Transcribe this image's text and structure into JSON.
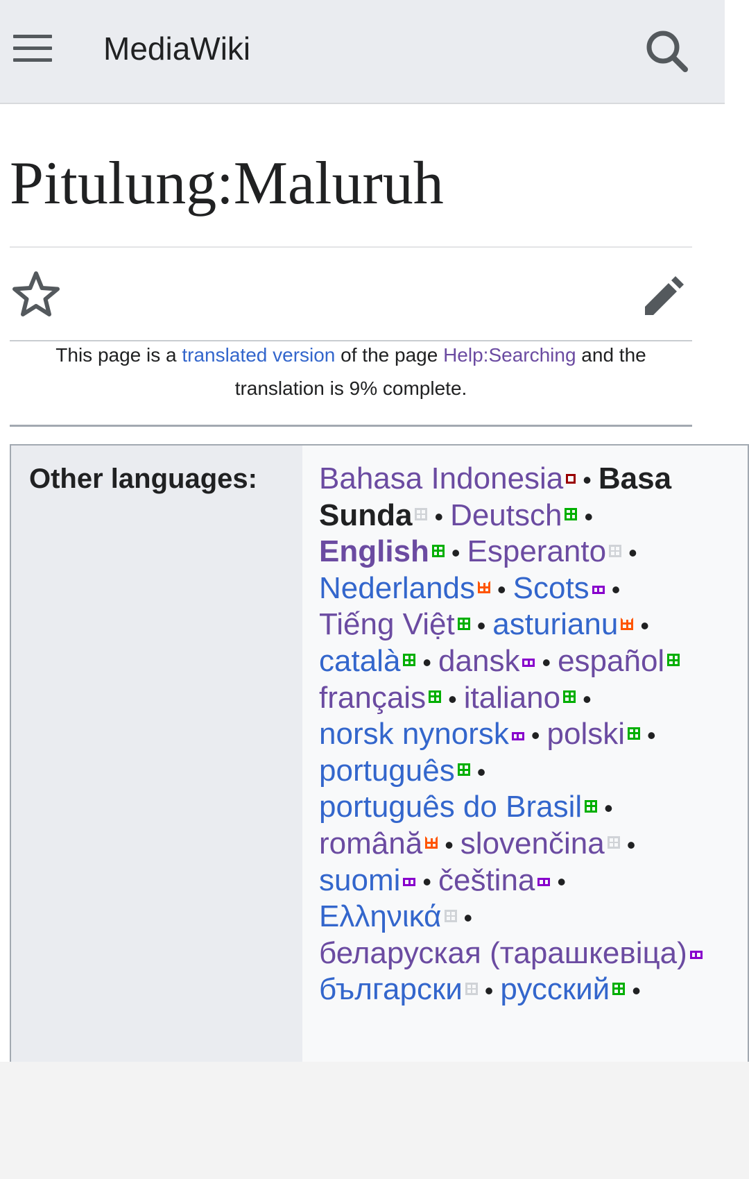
{
  "header": {
    "site_title": "MediaWiki",
    "menu_icon": "hamburger-menu-icon",
    "search_icon": "search-icon"
  },
  "page": {
    "title": "Pitulung:Maluruh",
    "watch_icon": "star-icon",
    "edit_icon": "pencil-icon"
  },
  "notice": {
    "text_1": "This page is a ",
    "link_1": "translated version",
    "text_2": " of the page ",
    "link_2": "Help:Searching",
    "text_3": " and the translation is 9% complete."
  },
  "languages": {
    "label": "Other languages:",
    "lines": [
      [
        {
          "name": "Bahasa Indonesia",
          "color": "purple",
          "status": "red"
        },
        {
          "sep": true
        },
        {
          "name": "Basa",
          "color": "dark",
          "bold": true
        }
      ],
      [
        {
          "name": "Sunda",
          "color": "dark",
          "bold": true,
          "status": "none"
        },
        {
          "sep": true
        },
        {
          "name": "Deutsch",
          "color": "purple",
          "status": "full"
        },
        {
          "sep": true
        }
      ],
      [
        {
          "name": "English",
          "color": "purple",
          "bold": true,
          "status": "full"
        },
        {
          "sep": true
        },
        {
          "name": "Esperanto",
          "color": "purple",
          "status": "none"
        },
        {
          "sep": true
        }
      ],
      [
        {
          "name": "Nederlands",
          "color": "blue",
          "status": "part"
        },
        {
          "sep": true
        },
        {
          "name": "Scots",
          "color": "blue",
          "status": "some"
        },
        {
          "sep": true
        }
      ],
      [
        {
          "name": "Tiếng Việt",
          "color": "purple",
          "status": "full"
        },
        {
          "sep": true
        },
        {
          "name": "asturianu",
          "color": "blue",
          "status": "part"
        },
        {
          "sep": true
        }
      ],
      [
        {
          "name": "català",
          "color": "blue",
          "status": "full"
        },
        {
          "sep": true
        },
        {
          "name": "dansk",
          "color": "purple",
          "status": "some"
        },
        {
          "sep": true
        },
        {
          "name": "español",
          "color": "purple",
          "status": "full"
        }
      ],
      [
        {
          "name": "français",
          "color": "purple",
          "status": "full"
        },
        {
          "sep": true
        },
        {
          "name": "italiano",
          "color": "purple",
          "status": "full"
        },
        {
          "sep": true
        }
      ],
      [
        {
          "name": "norsk nynorsk",
          "color": "blue",
          "status": "some"
        },
        {
          "sep": true
        },
        {
          "name": "polski",
          "color": "purple",
          "status": "full"
        },
        {
          "sep": true
        }
      ],
      [
        {
          "name": "português",
          "color": "blue",
          "status": "full"
        },
        {
          "sep": true
        }
      ],
      [
        {
          "name": "português do Brasil",
          "color": "blue",
          "status": "full"
        },
        {
          "sep": true
        }
      ],
      [
        {
          "name": "română",
          "color": "purple",
          "status": "part"
        },
        {
          "sep": true
        },
        {
          "name": "slovenčina",
          "color": "purple",
          "status": "none"
        },
        {
          "sep": true
        }
      ],
      [
        {
          "name": "suomi",
          "color": "blue",
          "status": "some"
        },
        {
          "sep": true
        },
        {
          "name": "čeština",
          "color": "purple",
          "status": "some"
        },
        {
          "sep": true
        }
      ],
      [
        {
          "name": "Ελληνικά",
          "color": "blue",
          "status": "none"
        },
        {
          "sep": true
        }
      ],
      [
        {
          "name": "беларуская (тарашкевіца)",
          "color": "purple",
          "status": "some"
        }
      ],
      [
        {
          "name": "български",
          "color": "blue",
          "status": "none"
        },
        {
          "sep": true
        },
        {
          "name": "русский",
          "color": "blue",
          "status": "full"
        },
        {
          "sep": true
        }
      ]
    ]
  },
  "colors": {
    "link_blue": "#3366cc",
    "link_visited": "#6b4ba1",
    "header_bg": "#eaecf0",
    "status_full": "#00af00",
    "status_partial": "#ff5500",
    "status_some": "#8800cc",
    "status_none": "#c8ccd1"
  }
}
